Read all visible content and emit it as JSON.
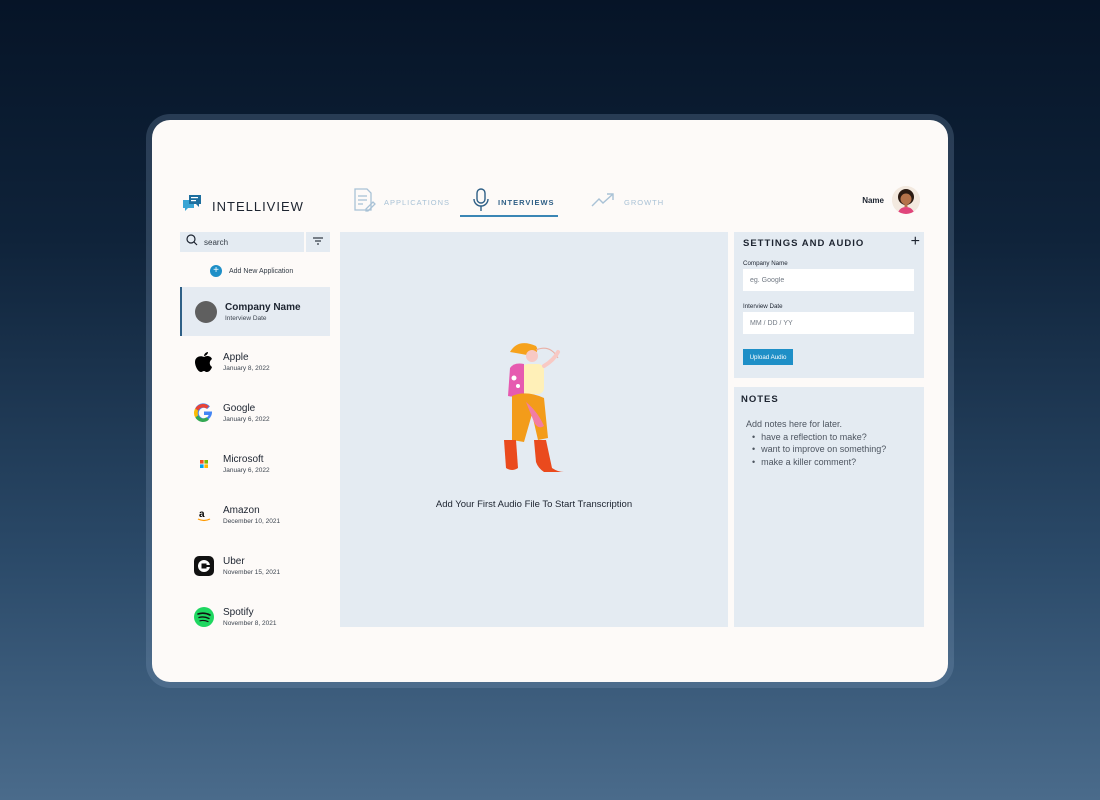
{
  "app": {
    "name": "INTELLIVIEW"
  },
  "nav": {
    "tabs": [
      {
        "label": "APPLICATIONS",
        "icon": "document-icon",
        "active": false
      },
      {
        "label": "INTERVIEWS",
        "icon": "microphone-icon",
        "active": true
      },
      {
        "label": "GROWTH",
        "icon": "trend-up-icon",
        "active": false
      }
    ]
  },
  "user": {
    "name": "Name"
  },
  "sidebar": {
    "search_placeholder": "search",
    "add_label": "Add New Application",
    "items": [
      {
        "name": "Company Name",
        "date": "Interview Date",
        "icon": "placeholder-circle-icon"
      },
      {
        "name": "Apple",
        "date": "January 8, 2022",
        "icon": "apple-logo-icon"
      },
      {
        "name": "Google",
        "date": "January 6, 2022",
        "icon": "google-logo-icon"
      },
      {
        "name": "Microsoft",
        "date": "January 6, 2022",
        "icon": "microsoft-logo-icon"
      },
      {
        "name": "Amazon",
        "date": "December 10, 2021",
        "icon": "amazon-logo-icon"
      },
      {
        "name": "Uber",
        "date": "November 15, 2021",
        "icon": "uber-logo-icon"
      },
      {
        "name": "Spotify",
        "date": "November 8, 2021",
        "icon": "spotify-logo-icon"
      }
    ]
  },
  "main": {
    "message": "Add Your First Audio File To Start Transcription"
  },
  "settings": {
    "title": "SETTINGS AND AUDIO",
    "company_label": "Company Name",
    "company_placeholder": "eg. Google",
    "date_label": "Interview Date",
    "date_placeholder": "MM / DD / YY",
    "upload_label": "Upload Audio"
  },
  "notes": {
    "title": "NOTES",
    "intro": "Add notes here for later.",
    "bullets": [
      "have a reflection to make?",
      "want to improve on something?",
      "make a killer comment?"
    ]
  },
  "colors": {
    "accent": "#1e8fc7",
    "panel": "#e4ebf2",
    "nav_inactive": "#a9c2d6"
  }
}
